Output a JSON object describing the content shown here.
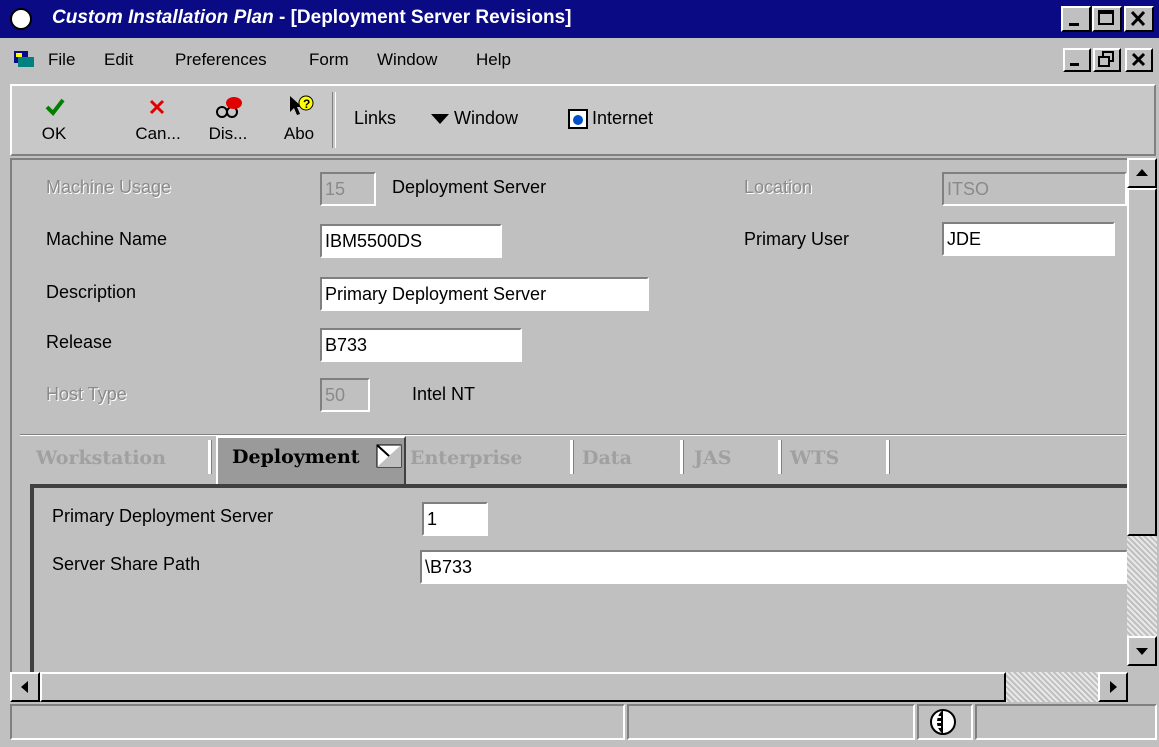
{
  "window": {
    "app_name": "Custom Installation Plan",
    "form_title": "- [Deployment Server Revisions]"
  },
  "menu": [
    "File",
    "Edit",
    "Preferences",
    "Form",
    "Window",
    "Help"
  ],
  "toolbar": {
    "buttons": [
      {
        "label": "OK",
        "icon": "check-icon"
      },
      {
        "label": "Can...",
        "icon": "cancel-x-icon"
      },
      {
        "label": "Dis...",
        "icon": "display-glasses-icon"
      },
      {
        "label": "Abo",
        "icon": "help-arrow-icon"
      }
    ],
    "links_label": "Links",
    "window_label": "Window",
    "internet_label": "Internet"
  },
  "form": {
    "machine_usage": {
      "label": "Machine Usage",
      "value": "15",
      "desc": "Deployment Server"
    },
    "location": {
      "label": "Location",
      "value": "ITSO"
    },
    "machine_name": {
      "label": "Machine Name",
      "value": "IBM5500DS"
    },
    "primary_user": {
      "label": "Primary User",
      "value": "JDE"
    },
    "description": {
      "label": "Description",
      "value": "Primary Deployment Server"
    },
    "release": {
      "label": "Release",
      "value": "B733"
    },
    "host_type": {
      "label": "Host Type",
      "value": "50",
      "desc": "Intel NT"
    }
  },
  "tabs": {
    "items": [
      "Workstation",
      "Deployment",
      "Enterprise",
      "Data",
      "JAS",
      "WTS"
    ],
    "active": "Deployment"
  },
  "deployment_tab": {
    "primary_deployment_server": {
      "label": "Primary Deployment Server",
      "value": "1"
    },
    "server_share_path": {
      "label": "Server Share Path",
      "value": "\\B733"
    }
  },
  "colors": {
    "title_bar": "#0a0a84",
    "window_bg": "#c0c0c0"
  }
}
